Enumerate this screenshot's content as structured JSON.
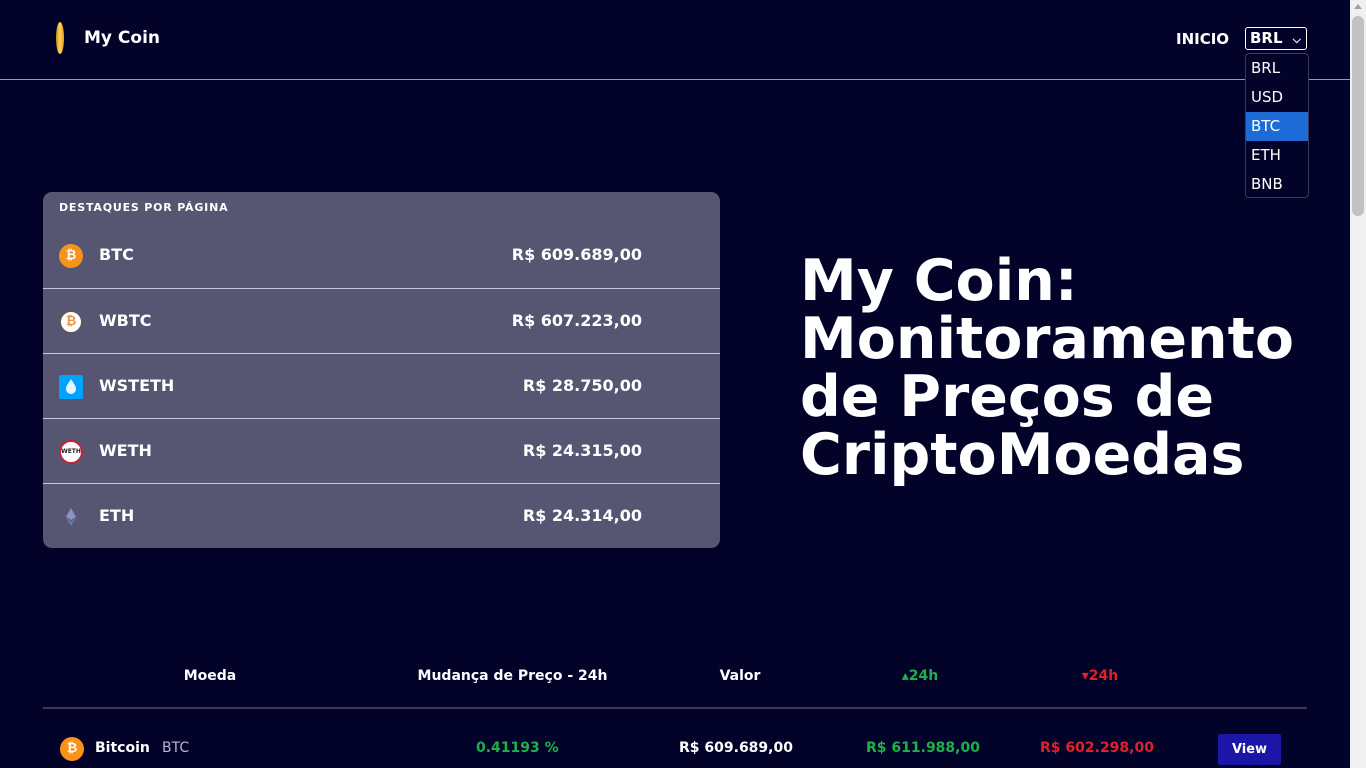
{
  "header": {
    "logo_text": "My Coin",
    "nav_inicio": "INICIO",
    "currency_selected": "BRL",
    "currency_options": [
      "BRL",
      "USD",
      "BTC",
      "ETH",
      "BNB"
    ],
    "currency_highlighted": "BTC"
  },
  "highlights": {
    "title": "DESTAQUES POR PÁGINA",
    "items": [
      {
        "symbol": "BTC",
        "price": "R$ 609.689,00"
      },
      {
        "symbol": "WBTC",
        "price": "R$ 607.223,00"
      },
      {
        "symbol": "WSTETH",
        "price": "R$ 28.750,00"
      },
      {
        "symbol": "WETH",
        "price": "R$ 24.315,00"
      },
      {
        "symbol": "ETH",
        "price": "R$ 24.314,00"
      }
    ]
  },
  "hero": {
    "line1": "My Coin:",
    "line2": "Monitoramento",
    "line3": "de Preços de",
    "line4": "CriptoMoedas"
  },
  "table": {
    "headers": {
      "coin": "Moeda",
      "change": "Mudança de Preço - 24h",
      "value": "Valor",
      "high": "24h",
      "low": "24h"
    },
    "rows": [
      {
        "name": "Bitcoin",
        "symbol": "BTC",
        "change": "0.41193 %",
        "value": "R$ 609.689,00",
        "high": "R$ 611.988,00",
        "low": "R$ 602.298,00",
        "action": "View"
      }
    ]
  },
  "colors": {
    "background": "#03032a",
    "card": "#575672",
    "positive": "#1fb04a",
    "negative": "#e0202a",
    "button": "#1b16a8",
    "highlight": "#1c6bd6"
  }
}
